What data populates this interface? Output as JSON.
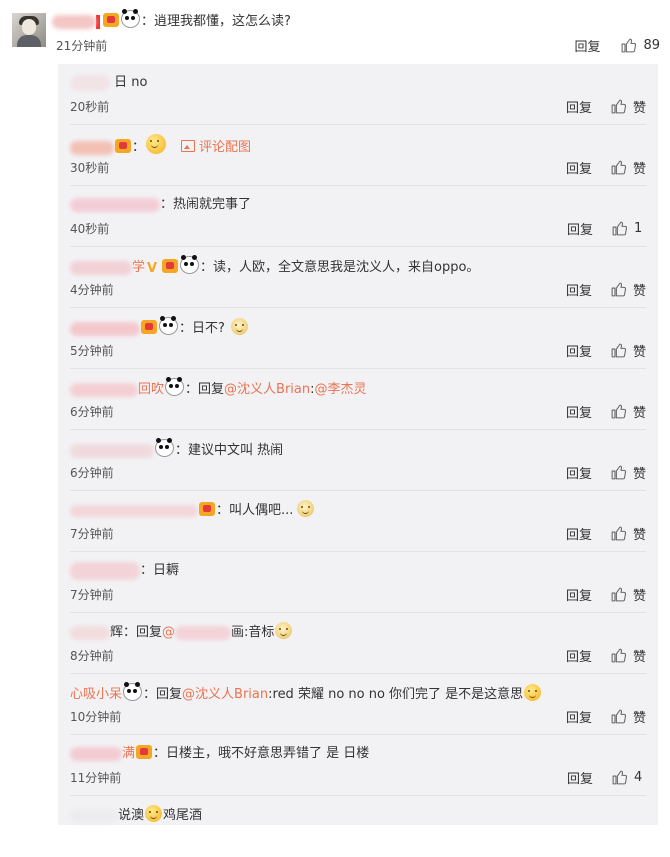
{
  "main_comment": {
    "text": "：逍理我都懂，这怎么读?",
    "time": "21分钟前",
    "reply_label": "回复",
    "like_count": "89"
  },
  "replies": [
    {
      "name": "",
      "text": "日 no",
      "time": "20秒前",
      "reply_label": "回复",
      "like_label": "赞"
    },
    {
      "name": "",
      "text": "",
      "pic_label": "评论配图",
      "time": "30秒前",
      "reply_label": "回复",
      "like_label": "赞"
    },
    {
      "name": "",
      "text": "：热闹就完事了",
      "time": "40秒前",
      "reply_label": "回复",
      "like_label": "1"
    },
    {
      "name": "学",
      "text": "：读，人欧，全文意思我是沈义人，来自oppo。",
      "time": "4分钟前",
      "reply_label": "回复",
      "like_label": "赞"
    },
    {
      "name": "",
      "text": "：日不?",
      "time": "5分钟前",
      "reply_label": "回复",
      "like_label": "赞"
    },
    {
      "name": "回吹",
      "text_prefix": "：回复",
      "mention1": "@沈义人Brian",
      "colon": ":",
      "mention2": "@李杰灵",
      "time": "6分钟前",
      "reply_label": "回复",
      "like_label": "赞"
    },
    {
      "name": "",
      "text": "：建议中文叫 热闹",
      "time": "6分钟前",
      "reply_label": "回复",
      "like_label": "赞"
    },
    {
      "name": "",
      "text": "：叫人偶吧...",
      "time": "7分钟前",
      "reply_label": "回复",
      "like_label": "赞"
    },
    {
      "name": "",
      "text": "：日耨",
      "time": "7分钟前",
      "reply_label": "回复",
      "like_label": "赞"
    },
    {
      "name": "辉",
      "text_prefix": "：回复",
      "mention1": "@",
      "mid": "画:音标",
      "time": "8分钟前",
      "reply_label": "回复",
      "like_label": "赞"
    },
    {
      "name": "心吸小呆",
      "text_prefix": "：回复",
      "mention1": "@沈义人Brian",
      "text_suffix": ":red  荣耀   no no no 你们完了  是不是这意思",
      "time": "10分钟前",
      "reply_label": "回复",
      "like_label": "赞"
    },
    {
      "name": "满",
      "text": "：日楼主，哦不好意思弄错了 是 日楼",
      "time": "11分钟前",
      "reply_label": "回复",
      "like_label": "4"
    },
    {
      "name": "",
      "text": "说澳",
      "text_suffix": "鸡尾酒",
      "time": "",
      "reply_label": "",
      "like_label": ""
    }
  ],
  "colors": {
    "link": "#eb7350",
    "panel": "#f2f2f5",
    "badge": "#f5a623"
  },
  "icons": {
    "like": "thumbs-up-icon",
    "pic": "picture-icon",
    "emoji": "smile-emoji"
  }
}
